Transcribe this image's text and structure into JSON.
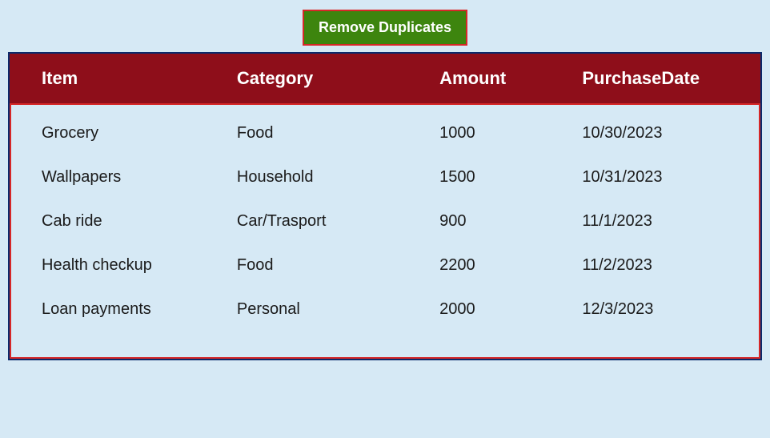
{
  "button": {
    "remove_duplicates_label": "Remove Duplicates"
  },
  "table": {
    "headers": {
      "item": "Item",
      "category": "Category",
      "amount": "Amount",
      "purchase_date": "PurchaseDate"
    },
    "rows": [
      {
        "item": "Grocery",
        "category": "Food",
        "amount": "1000",
        "purchase_date": "10/30/2023"
      },
      {
        "item": "Wallpapers",
        "category": "Household",
        "amount": "1500",
        "purchase_date": "10/31/2023"
      },
      {
        "item": "Cab ride",
        "category": "Car/Trasport",
        "amount": "900",
        "purchase_date": "11/1/2023"
      },
      {
        "item": "Health checkup",
        "category": "Food",
        "amount": "2200",
        "purchase_date": "11/2/2023"
      },
      {
        "item": "Loan payments",
        "category": "Personal",
        "amount": "2000",
        "purchase_date": "12/3/2023"
      }
    ]
  }
}
